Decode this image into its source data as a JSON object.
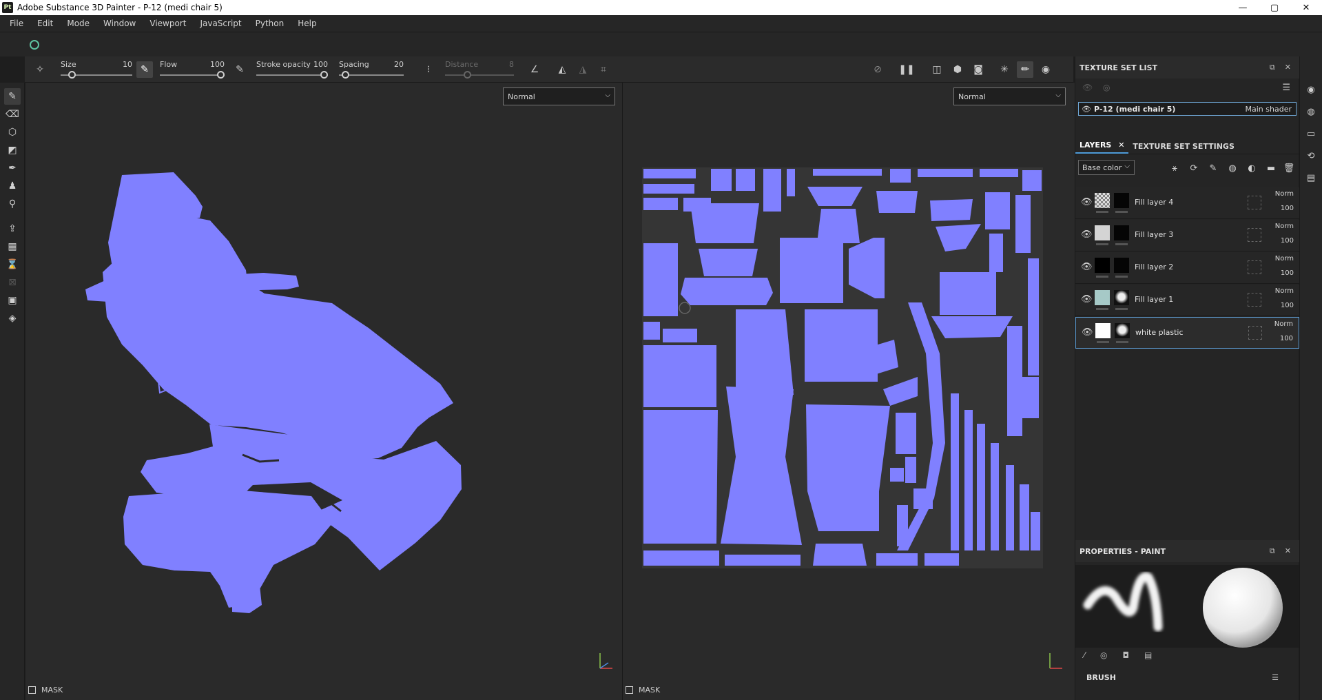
{
  "window": {
    "app_badge": "Pt",
    "title": "Adobe Substance 3D Painter - P-12 (medi chair 5)",
    "controls": [
      "—",
      "▢",
      "✕"
    ]
  },
  "menu": [
    "File",
    "Edit",
    "Mode",
    "Window",
    "Viewport",
    "JavaScript",
    "Python",
    "Help"
  ],
  "tool_options": {
    "size": {
      "label": "Size",
      "value": "10",
      "fraction": 0.12
    },
    "flow": {
      "label": "Flow",
      "value": "100",
      "fraction": 1.0
    },
    "stroke_opacity": {
      "label": "Stroke opacity",
      "value": "100",
      "fraction": 1.0
    },
    "spacing": {
      "label": "Spacing",
      "value": "20",
      "fraction": 0.05
    },
    "distance": {
      "label": "Distance",
      "value": "8",
      "fraction": 0.3
    }
  },
  "viewports": {
    "left": {
      "mode": "Normal",
      "mask_label": "MASK"
    },
    "right": {
      "mode": "Normal",
      "mask_label": "MASK"
    }
  },
  "texture_set_list": {
    "title": "TEXTURE SET LIST",
    "items": [
      {
        "name": "P-12 (medi chair 5)",
        "shader": "Main shader"
      }
    ]
  },
  "layers_panel": {
    "tabs": [
      "LAYERS",
      "TEXTURE SET SETTINGS"
    ],
    "channel": "Base color",
    "layers": [
      {
        "name": "Fill layer 4",
        "blend": "Norm",
        "opacity": "100",
        "thumb": "checker"
      },
      {
        "name": "Fill layer 3",
        "blend": "Norm",
        "opacity": "100",
        "thumb": "#d4d4d4"
      },
      {
        "name": "Fill layer 2",
        "blend": "Norm",
        "opacity": "100",
        "thumb": "#000000"
      },
      {
        "name": "Fill layer 1",
        "blend": "Norm",
        "opacity": "100",
        "thumb": "#a6c9c7"
      },
      {
        "name": "white plastic",
        "blend": "Norm",
        "opacity": "100",
        "thumb": "#ffffff"
      }
    ]
  },
  "properties": {
    "title": "PROPERTIES - PAINT",
    "brush_section": "BRUSH"
  },
  "colors": {
    "mesh_fill": "#8080ff",
    "accent": "#4f9cd9"
  }
}
